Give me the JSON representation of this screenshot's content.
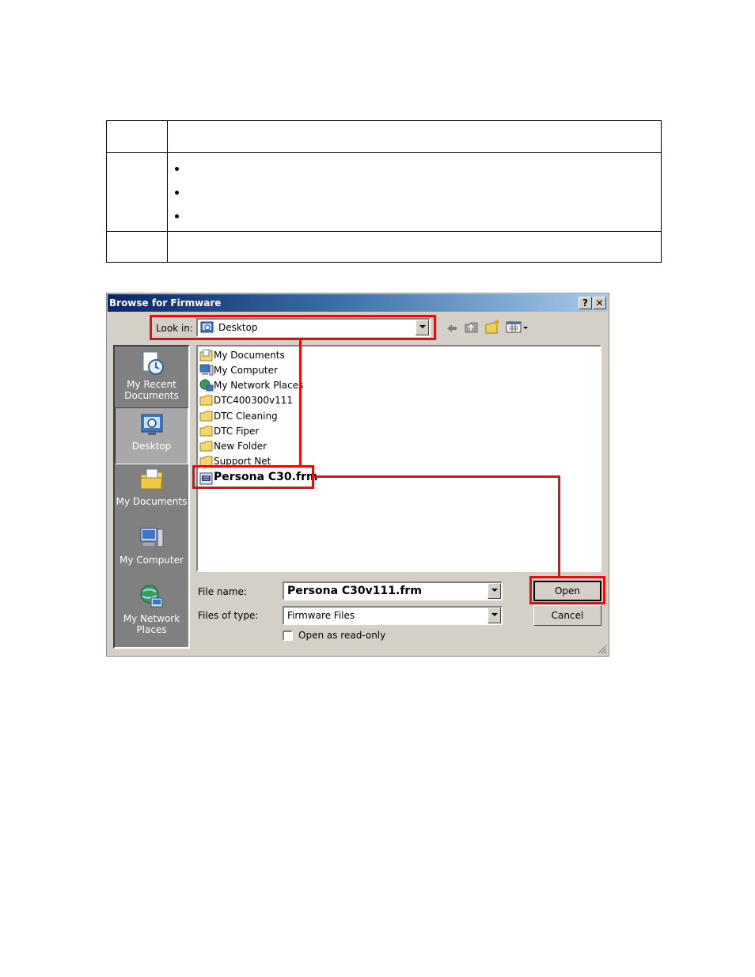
{
  "dialog": {
    "title": "Browse for Firmware",
    "help_label": "?",
    "close_label": "✕",
    "look_in": {
      "label": "Look in:",
      "value": "Desktop"
    },
    "places": [
      {
        "label": "My Recent Documents",
        "icon": "recent-documents-icon"
      },
      {
        "label": "Desktop",
        "icon": "desktop-icon",
        "active": true
      },
      {
        "label": "My Documents",
        "icon": "my-documents-icon"
      },
      {
        "label": "My Computer",
        "icon": "my-computer-icon"
      },
      {
        "label": "My Network Places",
        "icon": "network-places-icon"
      }
    ],
    "files": [
      {
        "name": "My Documents",
        "icon": "my-documents-icon"
      },
      {
        "name": "My Computer",
        "icon": "my-computer-icon"
      },
      {
        "name": "My Network Places",
        "icon": "network-places-icon"
      },
      {
        "name": "DTC400300v111",
        "icon": "folder-icon"
      },
      {
        "name": "DTC Cleaning",
        "icon": "folder-icon"
      },
      {
        "name": "DTC Fiper",
        "icon": "folder-icon"
      },
      {
        "name": "New Folder",
        "icon": "folder-icon"
      },
      {
        "name": "Support Net",
        "icon": "folder-icon"
      },
      {
        "name": "Persona C30.frm",
        "icon": "firmware-file-icon"
      }
    ],
    "file_name": {
      "label": "File name:",
      "value": "Persona C30v111.frm"
    },
    "file_type": {
      "label": "Files of type:",
      "value": "Firmware Files"
    },
    "read_only_label": "Open as read-only",
    "open_label": "Open",
    "cancel_label": "Cancel"
  },
  "colors": {
    "highlight": "#e01010",
    "title_gradient_start": "#0a246a",
    "dialog_face": "#d4d0c8"
  }
}
